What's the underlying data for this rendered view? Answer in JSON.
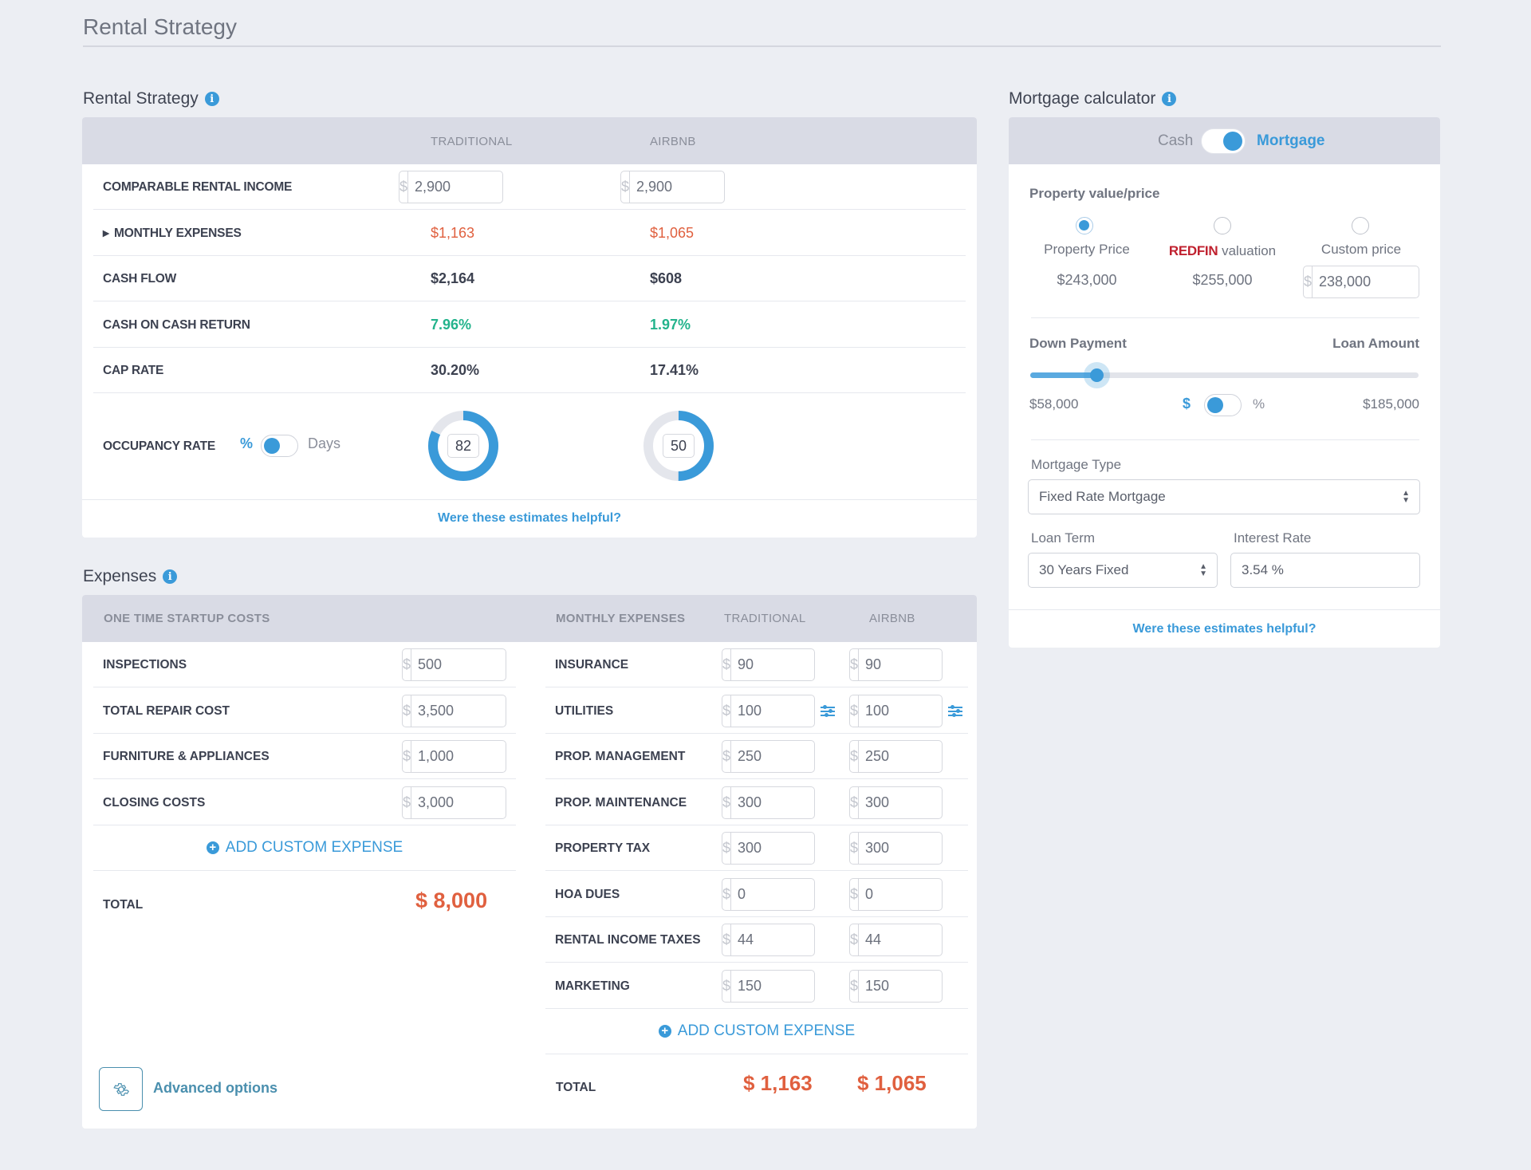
{
  "page": {
    "title": "Rental Strategy"
  },
  "rental_strategy": {
    "title": "Rental Strategy",
    "columns": [
      "TRADITIONAL",
      "AIRBNB"
    ],
    "currency_symbol": "$",
    "comparable_rental_income": {
      "label": "COMPARABLE RENTAL INCOME",
      "traditional": "2,900",
      "airbnb": "2,900"
    },
    "monthly_expenses": {
      "label": "MONTHLY EXPENSES",
      "traditional": "$1,163",
      "airbnb": "$1,065"
    },
    "cash_flow": {
      "label": "CASH FLOW",
      "traditional": "$2,164",
      "airbnb": "$608"
    },
    "cash_on_cash_return": {
      "label": "CASH ON CASH RETURN",
      "traditional": "7.96%",
      "airbnb": "1.97%"
    },
    "cap_rate": {
      "label": "CAP RATE",
      "traditional": "30.20%",
      "airbnb": "17.41%"
    },
    "occupancy_rate": {
      "label": "OCCUPANCY RATE",
      "unit_toggle": {
        "left": "%",
        "right": "Days",
        "selected": "%"
      },
      "traditional": 82,
      "airbnb": 50
    },
    "feedback_link": "Were these estimates helpful?"
  },
  "mortgage_calculator": {
    "title": "Mortgage calculator",
    "mode_toggle": {
      "left": "Cash",
      "right": "Mortgage",
      "selected": "Mortgage"
    },
    "property_value_label": "Property value/price",
    "options": [
      {
        "label": "Property Price",
        "value": "$243,000",
        "selected": true
      },
      {
        "brand": "REDFIN",
        "label": "valuation",
        "value": "$255,000",
        "selected": false
      },
      {
        "label": "Custom price",
        "value": "238,000",
        "selected": false
      }
    ],
    "currency_symbol": "$",
    "down_payment_label": "Down Payment",
    "loan_amount_label": "Loan Amount",
    "down_payment_value": "$58,000",
    "loan_amount_value": "$185,000",
    "slider_fraction": 0.17,
    "unit_toggle": {
      "left": "$",
      "right": "%",
      "selected": "$"
    },
    "mortgage_type_label": "Mortgage Type",
    "mortgage_type_value": "Fixed Rate Mortgage",
    "loan_term_label": "Loan Term",
    "loan_term_value": "30 Years Fixed",
    "interest_rate_label": "Interest Rate",
    "interest_rate_value": "3.54 %",
    "feedback_link": "Were these estimates helpful?"
  },
  "expenses": {
    "title": "Expenses",
    "currency_symbol": "$",
    "startup": {
      "header": "ONE TIME STARTUP COSTS",
      "items": [
        {
          "label": "INSPECTIONS",
          "value": "500"
        },
        {
          "label": "TOTAL REPAIR COST",
          "value": "3,500"
        },
        {
          "label": "FURNITURE & APPLIANCES",
          "value": "1,000"
        },
        {
          "label": "CLOSING COSTS",
          "value": "3,000"
        }
      ],
      "add_label": "ADD CUSTOM EXPENSE",
      "total_label": "TOTAL",
      "total_value": "$ 8,000"
    },
    "monthly": {
      "header": "MONTHLY EXPENSES",
      "columns": [
        "TRADITIONAL",
        "AIRBNB"
      ],
      "items": [
        {
          "label": "INSURANCE",
          "traditional": "90",
          "airbnb": "90",
          "adjustable": false
        },
        {
          "label": "UTILITIES",
          "traditional": "100",
          "airbnb": "100",
          "adjustable": true
        },
        {
          "label": "PROP. MANAGEMENT",
          "traditional": "250",
          "airbnb": "250",
          "adjustable": false
        },
        {
          "label": "PROP. MAINTENANCE",
          "traditional": "300",
          "airbnb": "300",
          "adjustable": false
        },
        {
          "label": "PROPERTY TAX",
          "traditional": "300",
          "airbnb": "300",
          "adjustable": false
        },
        {
          "label": "HOA DUES",
          "traditional": "0",
          "airbnb": "0",
          "adjustable": false
        },
        {
          "label": "RENTAL INCOME TAXES",
          "traditional": "44",
          "airbnb": "44",
          "adjustable": false
        },
        {
          "label": "MARKETING",
          "traditional": "150",
          "airbnb": "150",
          "adjustable": false
        }
      ],
      "add_label": "ADD CUSTOM EXPENSE",
      "total_label": "TOTAL",
      "total_traditional": "$ 1,163",
      "total_airbnb": "$ 1,065"
    },
    "advanced_options_label": "Advanced options"
  },
  "colors": {
    "accent": "#3a9ad9",
    "negative": "#e0603f",
    "positive": "#23b38c",
    "header_bg": "#d9dbe5",
    "page_bg": "#eceef3"
  }
}
